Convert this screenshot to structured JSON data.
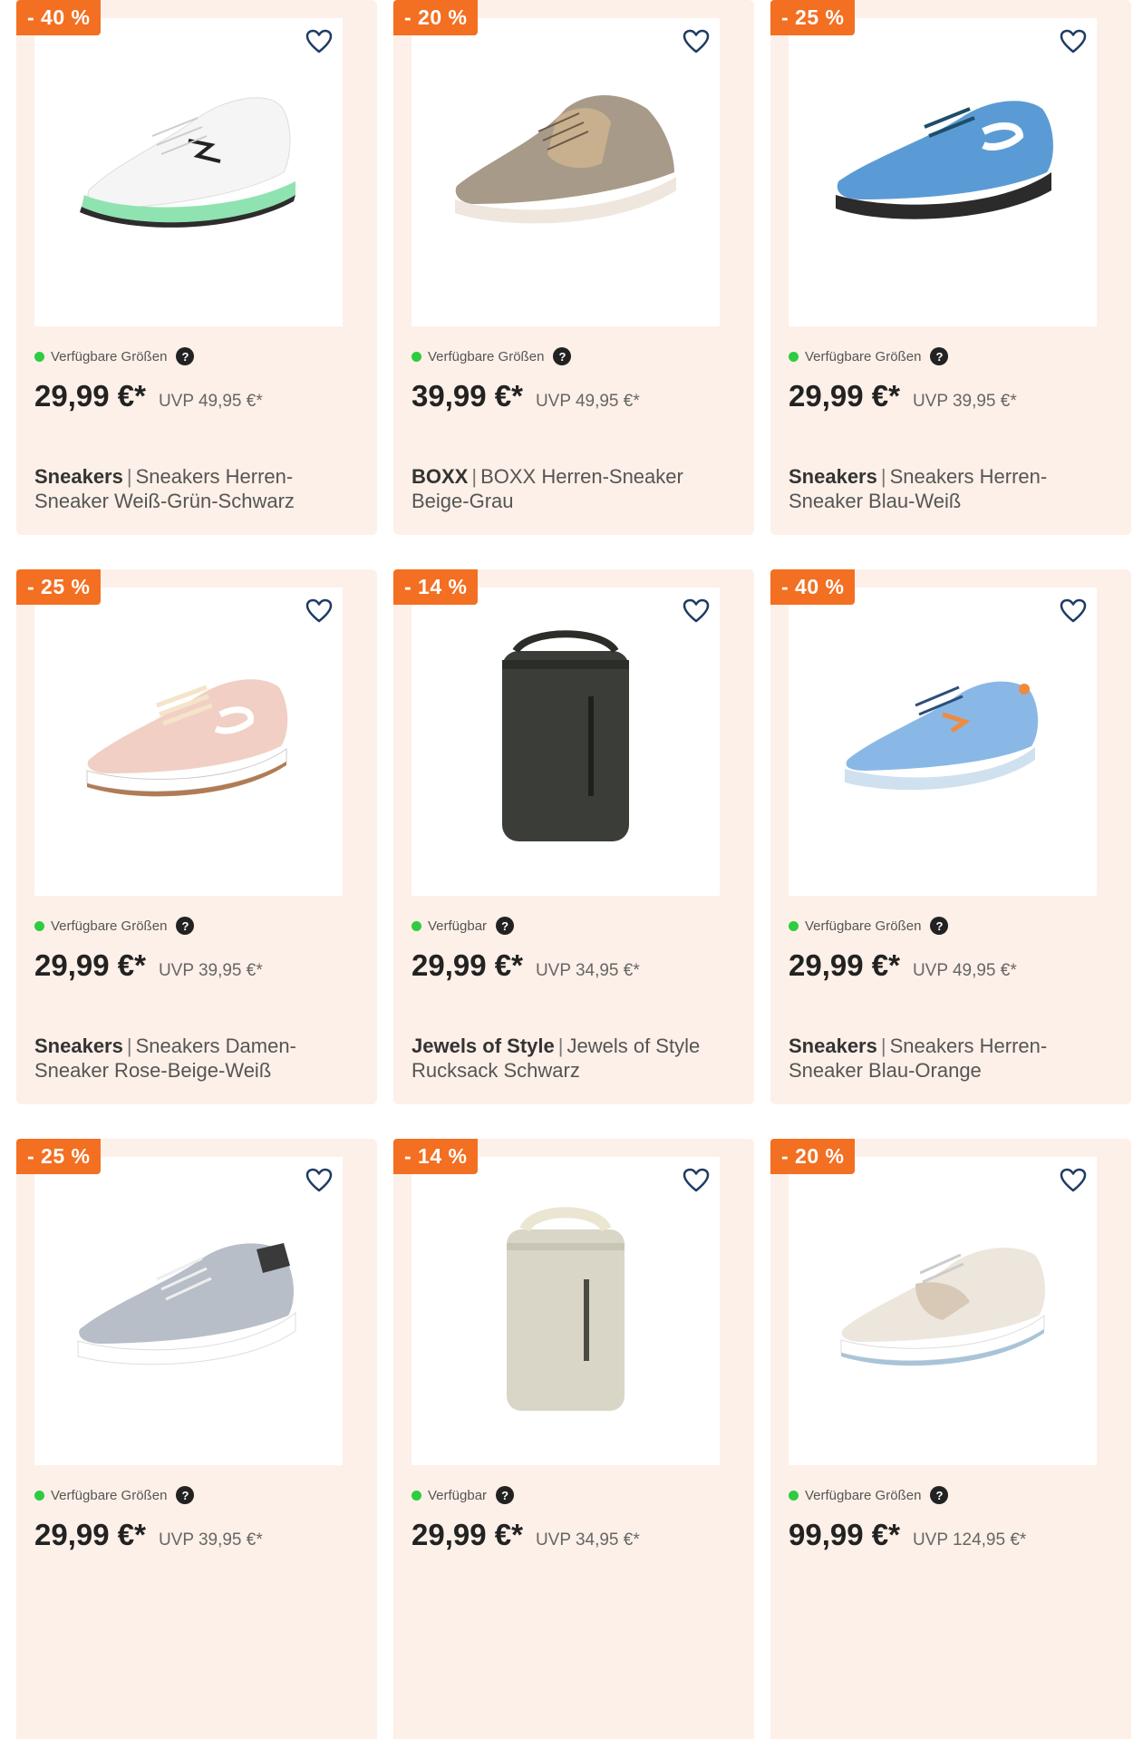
{
  "products": [
    {
      "discount": "- 40 %",
      "availability": "Verfügbare Größen",
      "price": "29,99 €*",
      "uvp": "UVP 49,95 €*",
      "brand": "Sneakers",
      "name": "Sneakers Herren-Sneaker Weiß-Grün-Schwarz",
      "image": "white-green-sneaker"
    },
    {
      "discount": "- 20 %",
      "availability": "Verfügbare Größen",
      "price": "39,99 €*",
      "uvp": "UVP 49,95 €*",
      "brand": "BOXX",
      "name": "BOXX Herren-Sneaker Beige-Grau",
      "image": "beige-grey-sneaker"
    },
    {
      "discount": "- 25 %",
      "availability": "Verfügbare Größen",
      "price": "29,99 €*",
      "uvp": "UVP 39,95 €*",
      "brand": "Sneakers",
      "name": "Sneakers Herren-Sneaker Blau-Weiß",
      "image": "blue-suede-sneaker"
    },
    {
      "discount": "- 25 %",
      "availability": "Verfügbare Größen",
      "price": "29,99 €*",
      "uvp": "UVP 39,95 €*",
      "brand": "Sneakers",
      "name": "Sneakers Damen-Sneaker Rose-Beige-Weiß",
      "image": "pink-sneaker"
    },
    {
      "discount": "- 14 %",
      "availability": "Verfügbar",
      "price": "29,99 €*",
      "uvp": "UVP 34,95 €*",
      "brand": "Jewels of Style",
      "name": "Jewels of Style Rucksack Schwarz",
      "image": "black-backpack"
    },
    {
      "discount": "- 40 %",
      "availability": "Verfügbare Größen",
      "price": "29,99 €*",
      "uvp": "UVP 49,95 €*",
      "brand": "Sneakers",
      "name": "Sneakers Herren-Sneaker Blau-Orange",
      "image": "light-blue-runner"
    },
    {
      "discount": "- 25 %",
      "availability": "Verfügbare Größen",
      "price": "29,99 €*",
      "uvp": "UVP 39,95 €*",
      "brand": "",
      "name": "",
      "image": "grey-knit-sneaker"
    },
    {
      "discount": "- 14 %",
      "availability": "Verfügbar",
      "price": "29,99 €*",
      "uvp": "UVP 34,95 €*",
      "brand": "",
      "name": "",
      "image": "beige-backpack"
    },
    {
      "discount": "- 20 %",
      "availability": "Verfügbare Größen",
      "price": "99,99 €*",
      "uvp": "UVP 124,95 €*",
      "brand": "",
      "name": "",
      "image": "cream-sneaker"
    }
  ],
  "colors": {
    "accent": "#f36f21",
    "card_bg": "#fdf0e8",
    "available": "#2ecc40"
  }
}
